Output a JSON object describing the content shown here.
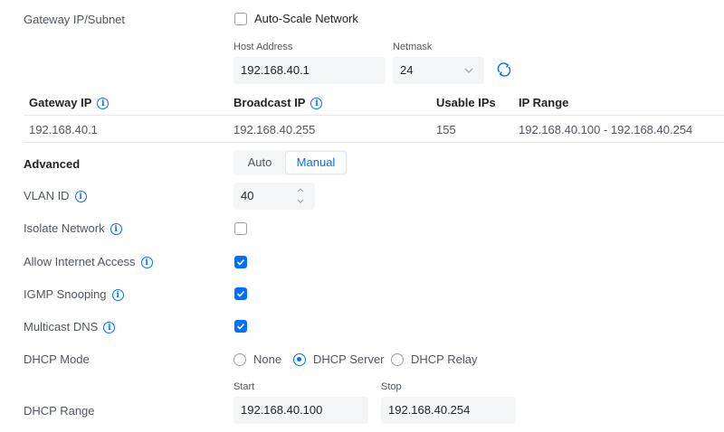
{
  "gateway": {
    "label": "Gateway IP/Subnet",
    "auto_scale_label": "Auto-Scale Network",
    "auto_scale_checked": false,
    "host_address_label": "Host Address",
    "host_address_value": "192.168.40.1",
    "netmask_label": "Netmask",
    "netmask_value": "24",
    "refresh_icon": "refresh-icon"
  },
  "table": {
    "headers": [
      "Gateway IP",
      "Broadcast IP",
      "Usable IPs",
      "IP Range"
    ],
    "row": [
      "192.168.40.1",
      "192.168.40.255",
      "155",
      "192.168.40.100 - 192.168.40.254"
    ]
  },
  "advanced": {
    "label": "Advanced",
    "options": [
      "Auto",
      "Manual"
    ],
    "selected": "Manual"
  },
  "vlan": {
    "label": "VLAN ID",
    "value": "40"
  },
  "isolate": {
    "label": "Isolate Network",
    "checked": false
  },
  "internet": {
    "label": "Allow Internet Access",
    "checked": true
  },
  "igmp": {
    "label": "IGMP Snooping",
    "checked": true
  },
  "mdns": {
    "label": "Multicast DNS",
    "checked": true
  },
  "dhcp_mode": {
    "label": "DHCP Mode",
    "options": [
      "None",
      "DHCP Server",
      "DHCP Relay"
    ],
    "selected": "DHCP Server"
  },
  "dhcp_range": {
    "label": "DHCP Range",
    "start_label": "Start",
    "start_value": "192.168.40.100",
    "stop_label": "Stop",
    "stop_value": "192.168.40.254"
  },
  "colors": {
    "accent": "#006fff",
    "input_bg": "#f4f5f6",
    "text": "#50565e"
  }
}
